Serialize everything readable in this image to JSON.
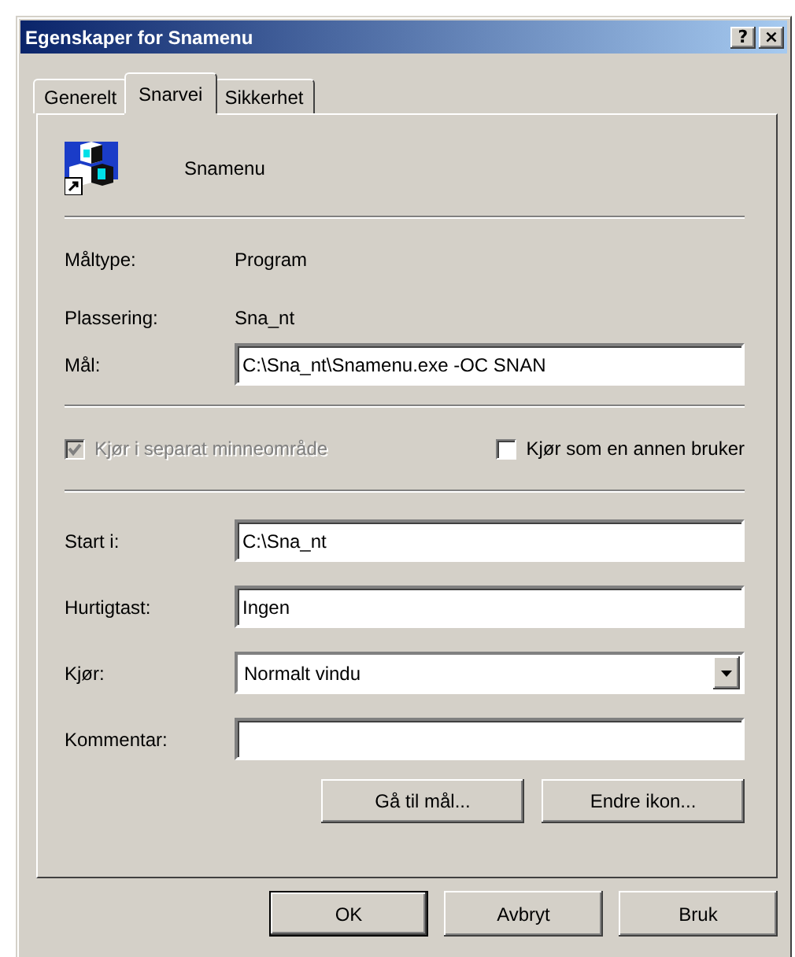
{
  "window": {
    "title": "Egenskaper for Snamenu",
    "help_button": "?",
    "close_button": "×"
  },
  "tabs": [
    {
      "label": "Generelt",
      "selected": false
    },
    {
      "label": "Snarvei",
      "selected": true
    },
    {
      "label": "Sikkerhet",
      "selected": false
    }
  ],
  "header": {
    "name": "Snamenu"
  },
  "info": [
    {
      "label": "Måltype:",
      "value": "Program"
    },
    {
      "label": "Plassering:",
      "value": "Sna_nt"
    }
  ],
  "target": {
    "label": "Mål:",
    "value": "C:\\Sna_nt\\Snamenu.exe -OC SNAN"
  },
  "checkboxes": [
    {
      "label": "Kjør i separat minneområde",
      "checked": true,
      "disabled": true
    },
    {
      "label": "Kjør som en annen bruker",
      "checked": false,
      "disabled": false
    }
  ],
  "fields": [
    {
      "kind": "text",
      "label": "Start i:",
      "value": "C:\\Sna_nt"
    },
    {
      "kind": "text",
      "label": "Hurtigtast:",
      "value": "Ingen"
    },
    {
      "kind": "dropdown",
      "label": "Kjør:",
      "value": "Normalt vindu"
    },
    {
      "kind": "text",
      "label": "Kommentar:"
    }
  ],
  "panel_buttons": [
    "Gå til mål...",
    "Endre ikon..."
  ],
  "dialog_buttons": [
    {
      "label": "OK",
      "default": true
    },
    {
      "label": "Avbryt",
      "default": false
    },
    {
      "label": "Bruk",
      "default": false
    }
  ]
}
